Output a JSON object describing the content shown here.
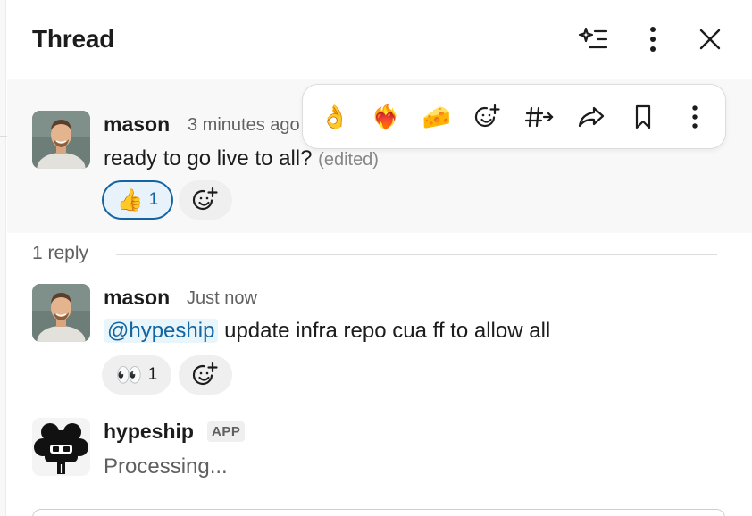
{
  "header": {
    "title": "Thread",
    "ai_icon": "sparkle-list-icon",
    "more_icon": "more-vertical-icon",
    "close_icon": "close-icon"
  },
  "parent_message": {
    "author": "mason",
    "time": "3 minutes ago",
    "text": "ready to go live to all?",
    "edited_label": "(edited)",
    "reactions": [
      {
        "emoji": "👍",
        "count": "1",
        "selected": true
      }
    ]
  },
  "hover_toolbar": {
    "emojis": [
      "👌",
      "❤️‍🔥",
      "🧀"
    ],
    "icons": [
      "add-reaction-icon",
      "channel-forward-icon",
      "share-icon",
      "bookmark-icon",
      "more-actions-icon"
    ]
  },
  "replies": {
    "count_label": "1 reply"
  },
  "reply_message": {
    "author": "mason",
    "time": "Just now",
    "mention": "@hypeship",
    "text": "update infra repo cua ff to allow all",
    "reactions": [
      {
        "emoji": "👀",
        "count": "1",
        "selected": false
      }
    ]
  },
  "bot_message": {
    "author": "hypeship",
    "badge": "APP",
    "text": "Processing..."
  },
  "colors": {
    "accent_blue": "#1264a3",
    "mention_bg": "#e8f5fa",
    "hover_bg": "#f8f8f8"
  }
}
